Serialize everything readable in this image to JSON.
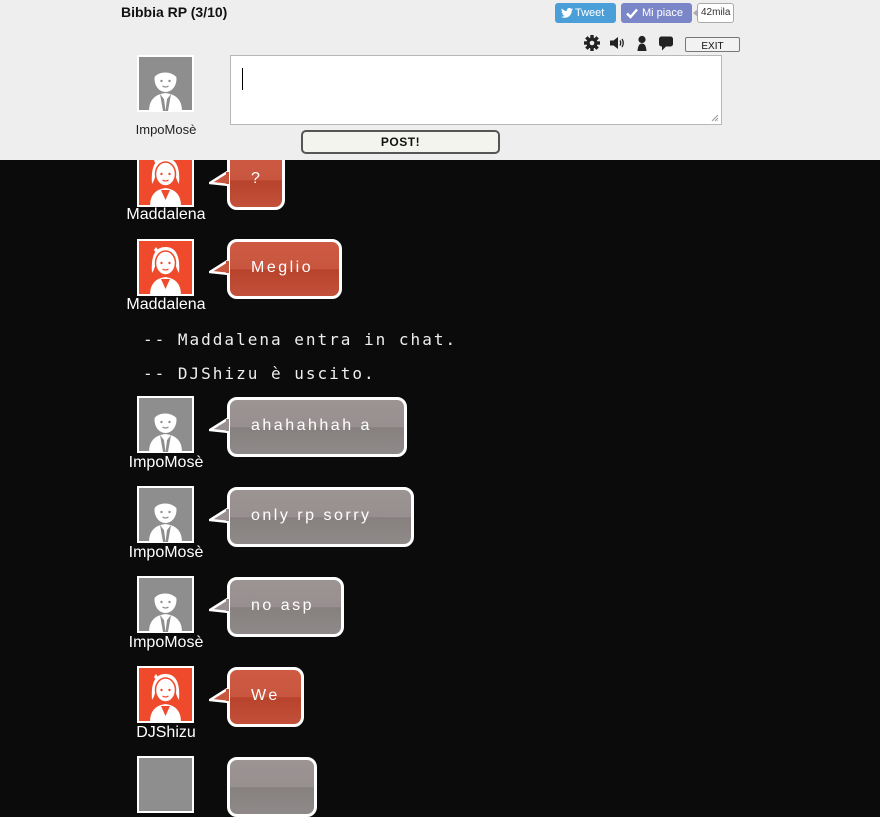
{
  "header": {
    "room_title": "Bibbia RP (3/10)",
    "tweet_label": "Tweet",
    "like_label": "Mi piace",
    "like_count": "42mila",
    "exit_label": "EXIT",
    "post_label": "POST!",
    "input_value": "",
    "my_name": "ImpoMosè"
  },
  "tools": [
    "settings-icon",
    "speaker-icon",
    "user-icon",
    "speech-bubble-icon"
  ],
  "messages": [
    {
      "type": "msg",
      "name": "Maddalena",
      "text": "?",
      "color": "red"
    },
    {
      "type": "msg",
      "name": "Maddalena",
      "text": "Meglio",
      "color": "red"
    },
    {
      "type": "system",
      "text": "-- Maddalena entra in chat."
    },
    {
      "type": "system",
      "text": "-- DJShizu è uscito."
    },
    {
      "type": "msg",
      "name": "ImpoMosè",
      "text": "ahahahhah a",
      "color": "gray"
    },
    {
      "type": "msg",
      "name": "ImpoMosè",
      "text": "only rp sorry",
      "color": "gray"
    },
    {
      "type": "msg",
      "name": "ImpoMosè",
      "text": "no asp",
      "color": "gray"
    },
    {
      "type": "msg",
      "name": "DJShizu",
      "text": "We",
      "color": "red"
    }
  ],
  "colors": {
    "red_avatar": "#f04a2c",
    "gray_avatar": "#8e8e8e",
    "bubble_red": "#c4503a",
    "bubble_gray": "#928c8b"
  }
}
